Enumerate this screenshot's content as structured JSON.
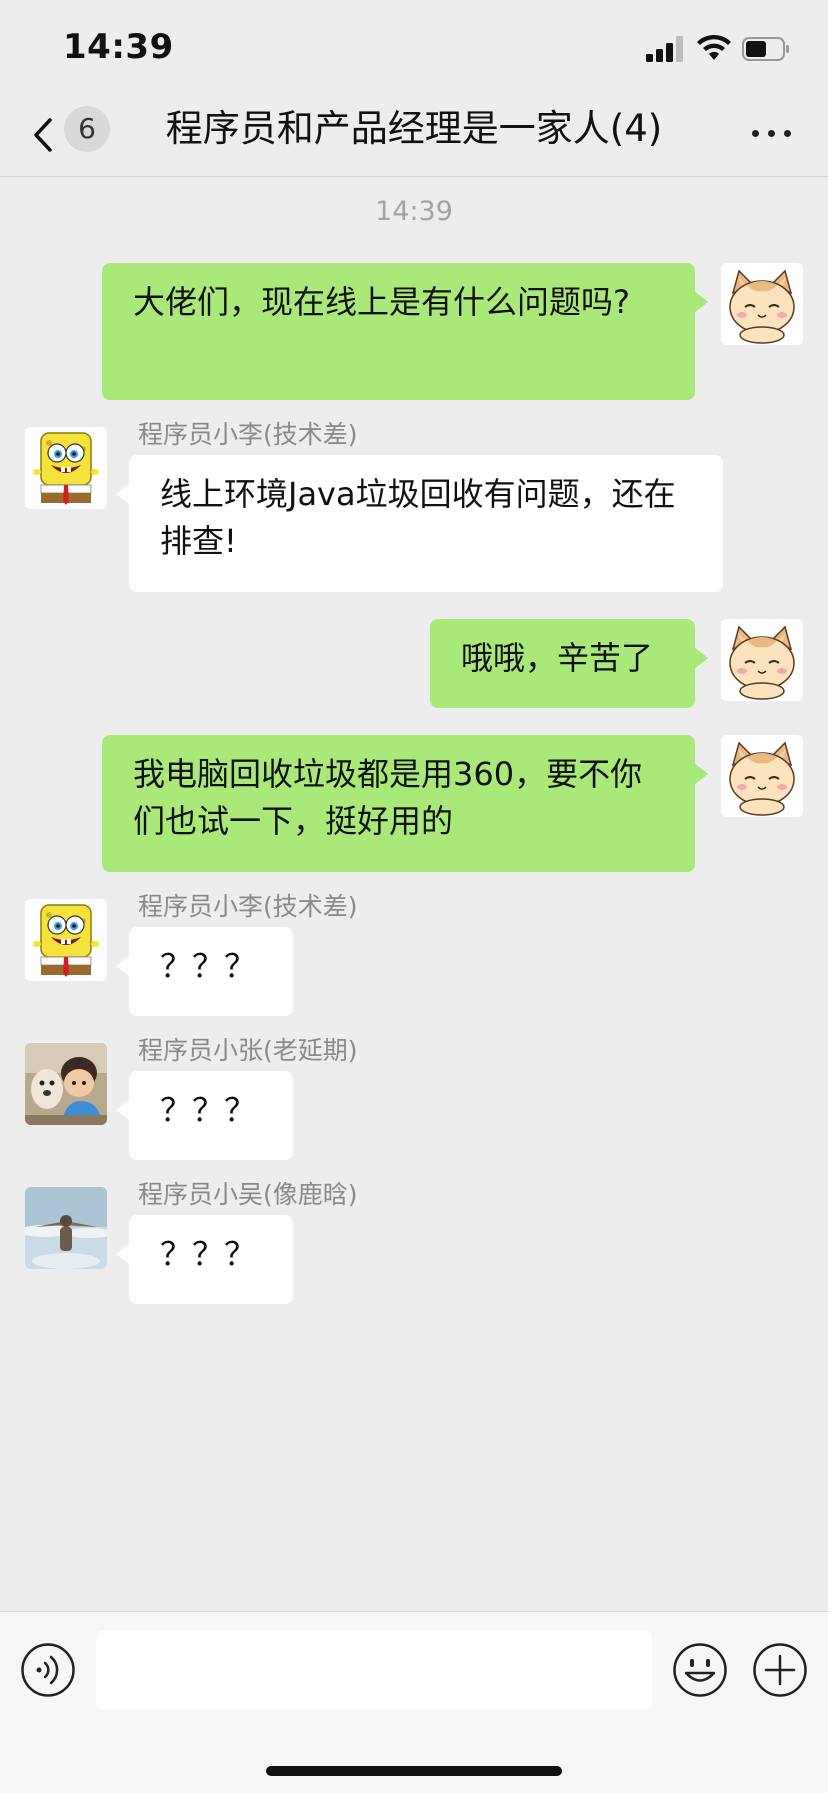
{
  "status_bar": {
    "time": "14:39"
  },
  "nav": {
    "back_icon": "chevron-left-icon",
    "unread_count": "6",
    "title": "程序员和产品经理是一家人(4)",
    "more_icon": "ellipsis-icon"
  },
  "chat": {
    "timestamp": "14:39",
    "messages": [
      {
        "side": "me",
        "avatar": "cat-avatar",
        "text": "大佬们，现在线上是有什么问题吗?"
      },
      {
        "side": "other",
        "sender": "程序员小李(技术差)",
        "avatar": "spongebob-avatar",
        "text": "线上环境Java垃圾回收有问题，还在排查!"
      },
      {
        "side": "me",
        "avatar": "cat-avatar",
        "text": "哦哦，辛苦了"
      },
      {
        "side": "me",
        "avatar": "cat-avatar",
        "text": "我电脑回收垃圾都是用360，要不你们也试一下，挺好用的"
      },
      {
        "side": "other",
        "sender": "程序员小李(技术差)",
        "avatar": "spongebob-avatar",
        "text": "？？？"
      },
      {
        "side": "other",
        "sender": "程序员小张(老延期)",
        "avatar": "child-photo-avatar",
        "text": "？？？"
      },
      {
        "side": "other",
        "sender": "程序员小吴(像鹿晗)",
        "avatar": "sky-photo-avatar",
        "text": "？？？"
      }
    ]
  },
  "input_bar": {
    "voice_icon": "voice-icon",
    "emoji_icon": "emoji-icon",
    "plus_icon": "plus-icon",
    "input_value": ""
  },
  "colors": {
    "my_bubble": "#a9e97a",
    "other_bubble": "#ffffff",
    "background": "#ededed"
  }
}
